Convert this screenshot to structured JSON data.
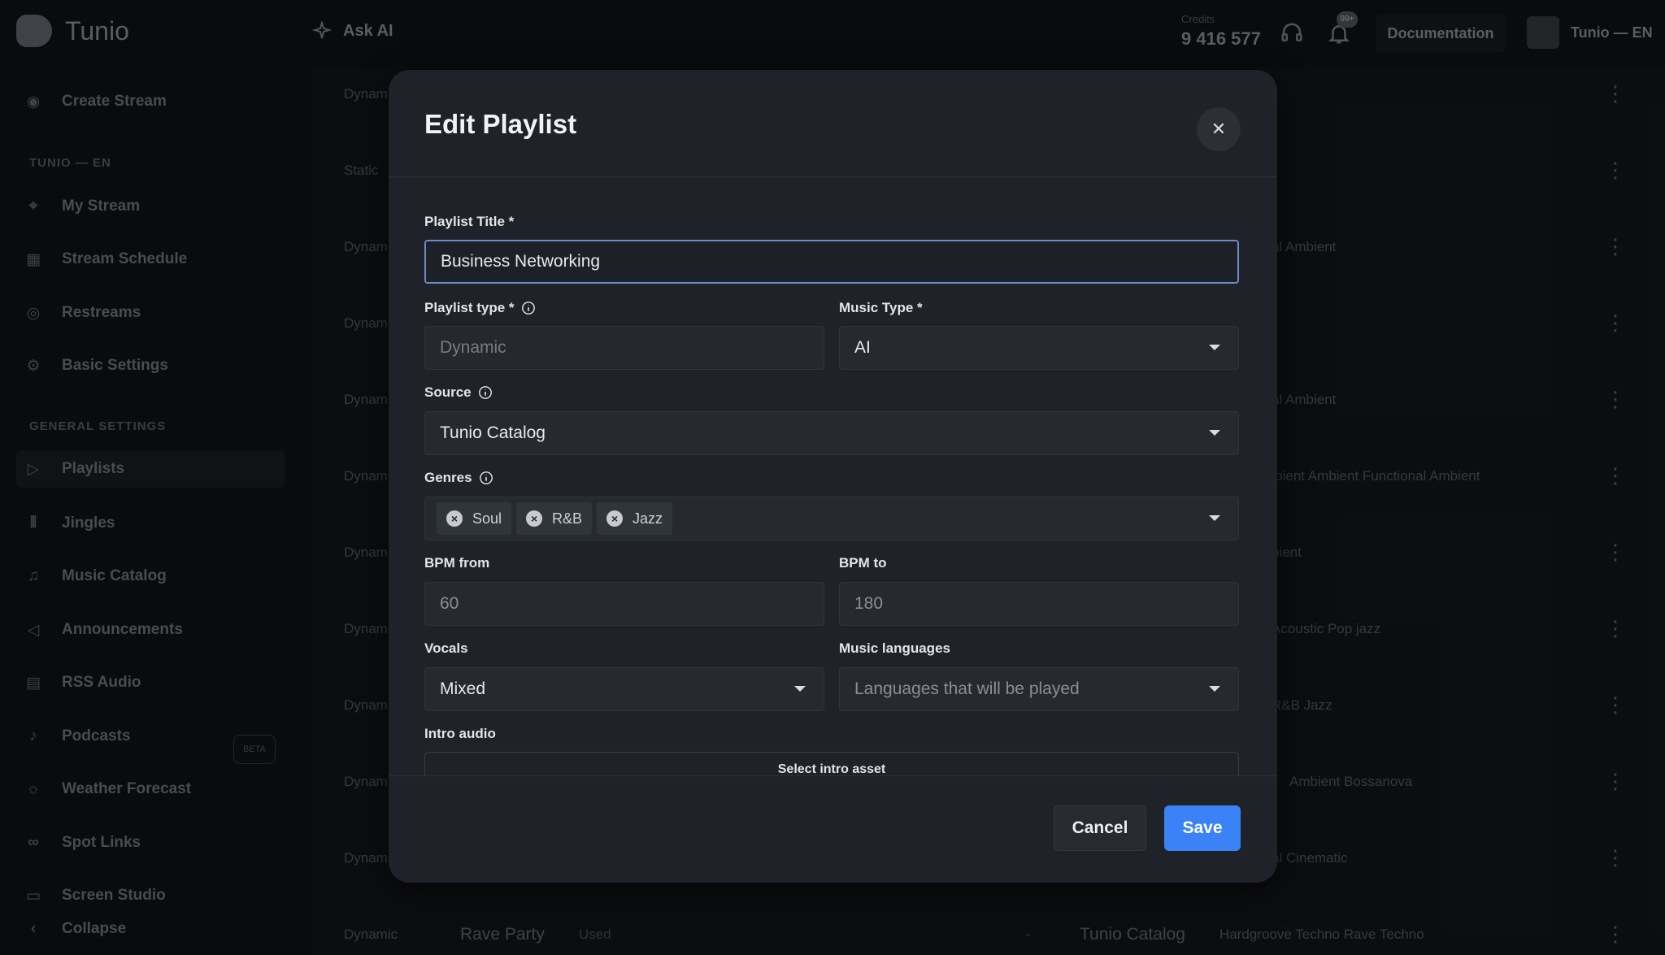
{
  "app": {
    "logo_text": "Tunio",
    "ask_ai": "Ask AI",
    "credits_label": "Credits",
    "credits_value": "9 416 577",
    "notifications_badge": "99+",
    "documentation": "Documentation",
    "account": "Tunio — EN"
  },
  "sidebar": {
    "create_stream": "Create Stream",
    "section_station": "TUNIO — EN",
    "section_general": "GENERAL SETTINGS",
    "items": [
      {
        "label": "My Stream"
      },
      {
        "label": "Stream Schedule"
      },
      {
        "label": "Restreams"
      },
      {
        "label": "Basic Settings"
      },
      {
        "label": "Playlists"
      },
      {
        "label": "Jingles"
      },
      {
        "label": "Music Catalog"
      },
      {
        "label": "Announcements"
      },
      {
        "label": "RSS Audio"
      },
      {
        "label": "Podcasts"
      },
      {
        "label": "Weather Forecast"
      },
      {
        "label": "Spot Links"
      },
      {
        "label": "Screen Studio"
      }
    ],
    "beta": "BETA",
    "collapse": "Collapse"
  },
  "background_rows": [
    {
      "type": "Dynamic",
      "tags": ""
    },
    {
      "type": "Static",
      "tags": ""
    },
    {
      "type": "Dynamic",
      "tags": "al Ambient"
    },
    {
      "type": "Dynamic",
      "tags": ""
    },
    {
      "type": "Dynamic",
      "tags": "al Ambient"
    },
    {
      "type": "Dynamic",
      "tags": "mbient     Ambient     Functional Ambient"
    },
    {
      "type": "Dynamic",
      "tags": "bient"
    },
    {
      "type": "Dynamic",
      "tags": "Acoustic     Pop jazz"
    },
    {
      "type": "Dynamic",
      "tags": "R&B     Jazz"
    },
    {
      "type": "Dynamic",
      "tags": "Ambient     Bossanova"
    },
    {
      "type": "Dynamic",
      "tags": "al Cinematic"
    }
  ],
  "last_row": {
    "type": "Dynamic",
    "title": "Rave Party",
    "used": "Used",
    "dash": "-",
    "source": "Tunio Catalog",
    "tags": "Hardgroove Techno     Rave Techno"
  },
  "modal": {
    "title": "Edit Playlist",
    "fields": {
      "title_label": "Playlist Title *",
      "title_value": "Business Networking",
      "type_label": "Playlist type *",
      "type_value": "Dynamic",
      "music_type_label": "Music Type *",
      "music_type_value": "AI",
      "source_label": "Source",
      "source_value": "Tunio Catalog",
      "genres_label": "Genres",
      "genres": [
        "Soul",
        "R&B",
        "Jazz"
      ],
      "bpm_from_label": "BPM from",
      "bpm_from_value": "60",
      "bpm_to_label": "BPM to",
      "bpm_to_value": "180",
      "vocals_label": "Vocals",
      "vocals_value": "Mixed",
      "languages_label": "Music languages",
      "languages_placeholder": "Languages that will be played",
      "intro_label": "Intro audio",
      "intro_button": "Select intro asset"
    },
    "cancel": "Cancel",
    "save": "Save"
  },
  "colors": {
    "accent": "#3b82f6",
    "modal_bg": "#1f2228",
    "focus_border": "#6d8cc7"
  }
}
